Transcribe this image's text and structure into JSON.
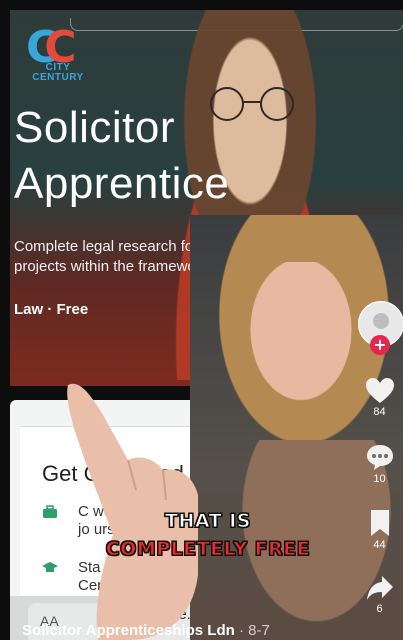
{
  "logo": {
    "name_line1": "CITY",
    "name_line2": "CENTURY",
    "mark": "CC"
  },
  "job_card": {
    "title": "Solicitor\nApprentice",
    "description": "Complete legal research for re\nprojects within the framewor",
    "tags": "Law · Free"
  },
  "detail_card": {
    "heading": "Get C     er Read",
    "row1": "C     work th\njo     urs",
    "row2": "Sta\nCent     ow\ncandi",
    "tail": "ge.",
    "aa": "AA"
  },
  "caption": {
    "line1": "THAT IS",
    "line2": "COMPLETELY FREE"
  },
  "actions": {
    "likes": "84",
    "comments": "10",
    "saves": "44",
    "shares": "6"
  },
  "footer": {
    "account": "Solicitor Apprenticeships Ldn",
    "date": "· 8-7"
  },
  "colors": {
    "brand_blue": "#39a6d9",
    "brand_red": "#e24a3b",
    "follow_red": "#e8254d",
    "caption_red": "#ee2a2a"
  }
}
